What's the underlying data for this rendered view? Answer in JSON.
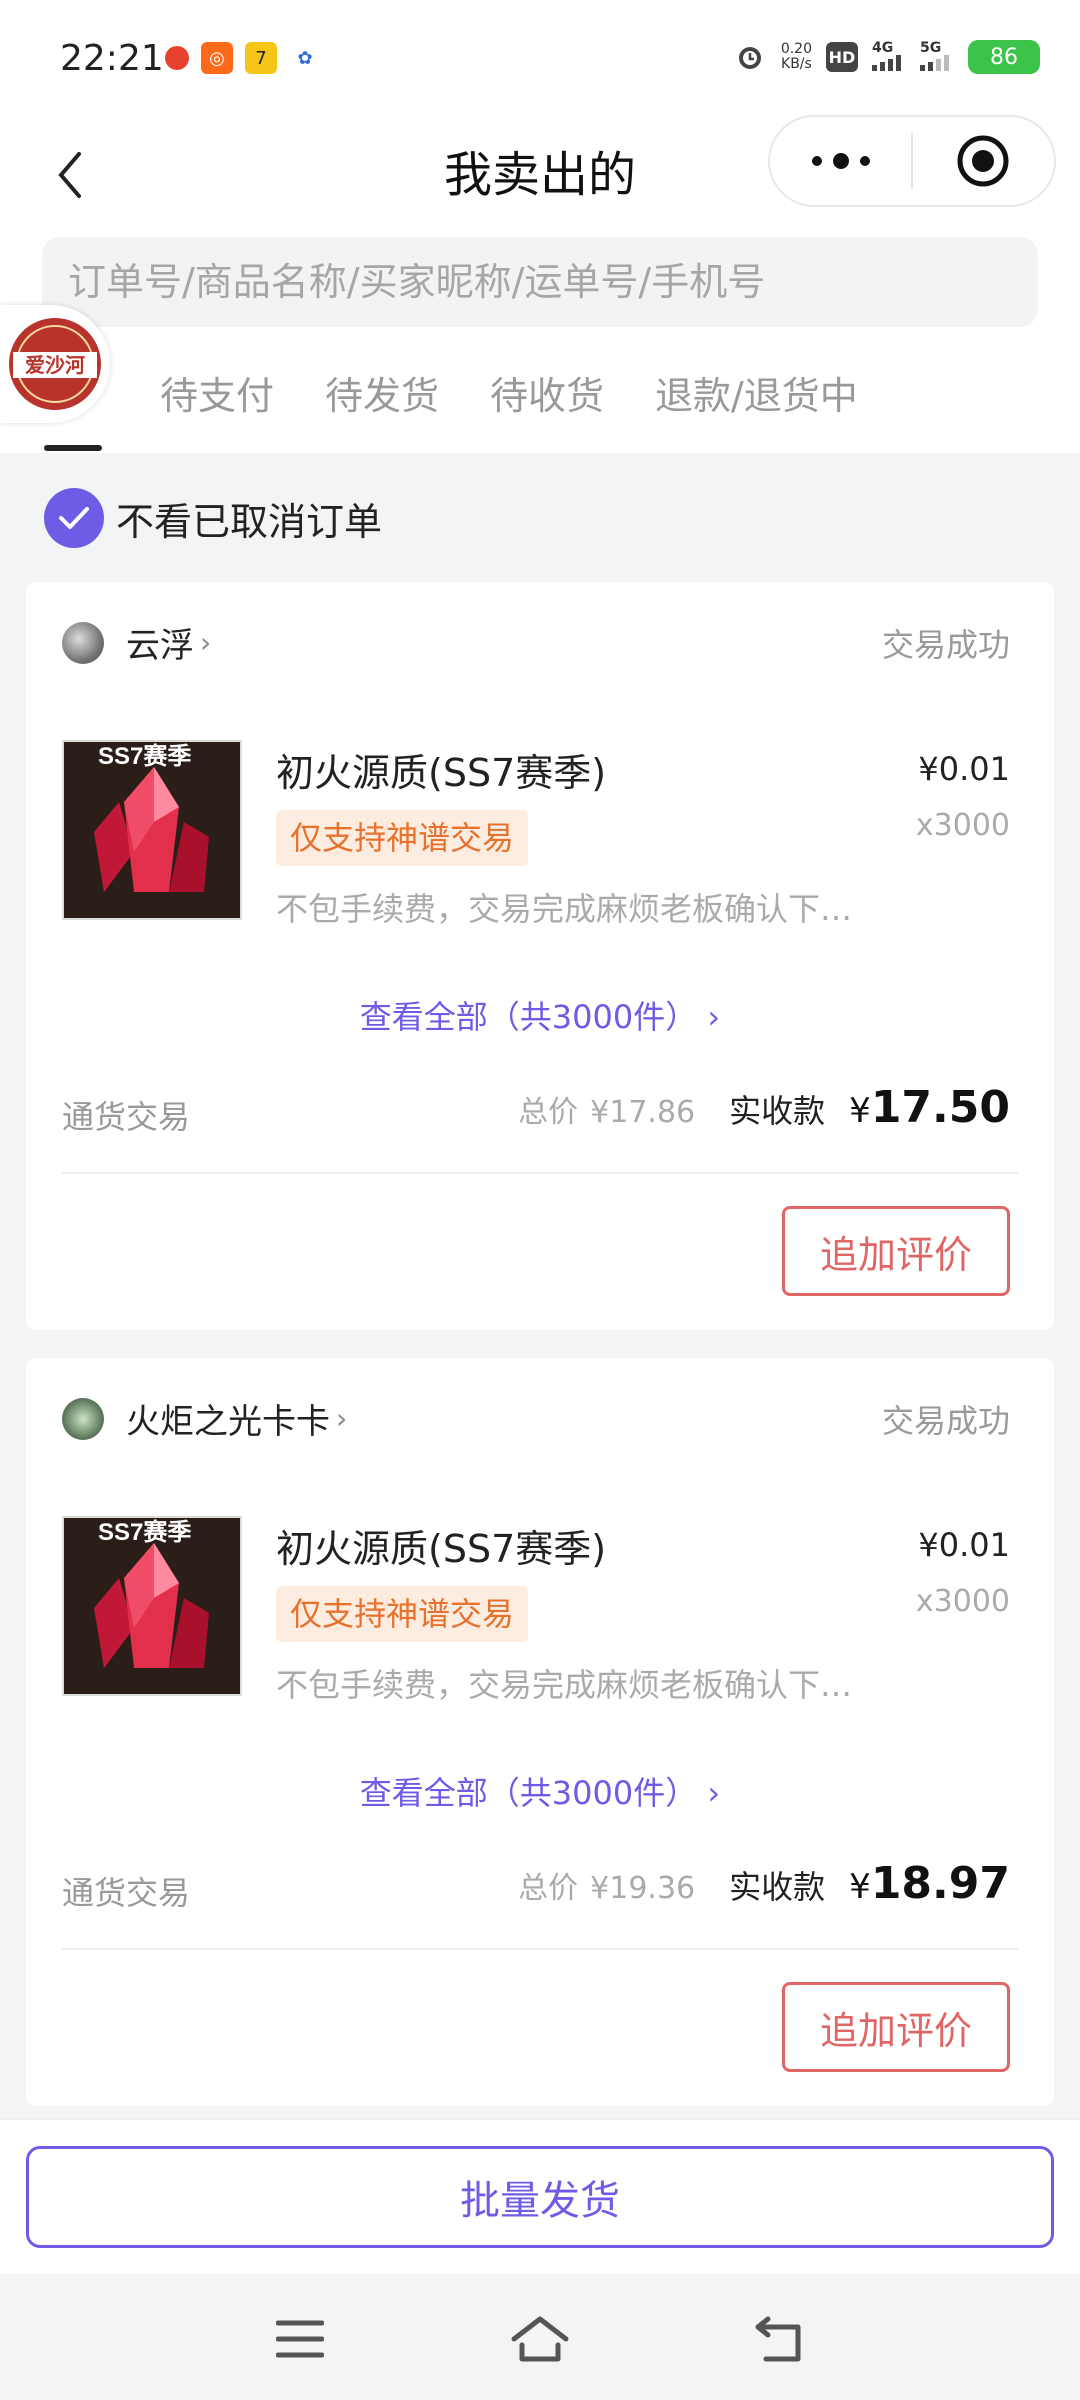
{
  "status_bar": {
    "time": "22:21",
    "net_speed_value": "0.20",
    "net_speed_unit": "KB/s",
    "hd_label": "HD",
    "net4g": "4G",
    "net5g": "5G",
    "battery": "86"
  },
  "nav": {
    "title": "我卖出的"
  },
  "search": {
    "placeholder": "订单号/商品名称/买家昵称/运单号/手机号"
  },
  "logo_text": "爱沙河",
  "tabs": [
    "待支付",
    "待发货",
    "待收货",
    "退款/退货中"
  ],
  "filter": {
    "label": "不看已取消订单",
    "checked": true
  },
  "orders": [
    {
      "seller": "云浮",
      "status": "交易成功",
      "item_name": "初火源质(SS7赛季)",
      "thumb_label": "SS7赛季",
      "tag": "仅支持神谱交易",
      "desc": "不包手续费，交易完成麻烦老板确认下…",
      "price": "¥0.01",
      "qty": "x3000",
      "view_all": "查看全部（共3000件）",
      "trade_type": "通货交易",
      "total_label": "总价",
      "total": "¥17.86",
      "received_label": "实收款",
      "received_symbol": "¥",
      "received": "17.50",
      "action": "追加评价"
    },
    {
      "seller": "火炬之光卡卡",
      "status": "交易成功",
      "item_name": "初火源质(SS7赛季)",
      "thumb_label": "SS7赛季",
      "tag": "仅支持神谱交易",
      "desc": "不包手续费，交易完成麻烦老板确认下…",
      "price": "¥0.01",
      "qty": "x3000",
      "view_all": "查看全部（共3000件）",
      "trade_type": "通货交易",
      "total_label": "总价",
      "total": "¥19.36",
      "received_label": "实收款",
      "received_symbol": "¥",
      "received": "18.97",
      "action": "追加评价"
    }
  ],
  "bottom": {
    "batch_button": "批量发货"
  },
  "colors": {
    "accent": "#6e5ce6",
    "review": "#e06565",
    "tag_text": "#e8712c",
    "tag_bg": "#fdece0",
    "battery": "#3cc34a"
  }
}
